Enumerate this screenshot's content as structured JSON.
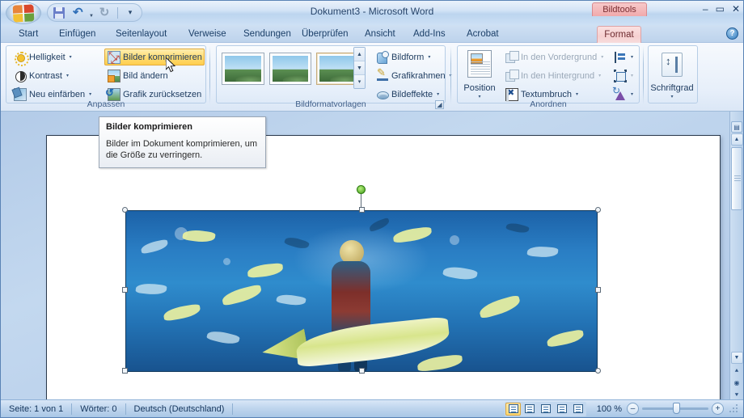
{
  "window": {
    "title": "Dokument3 - Microsoft Word",
    "contextual_tab_label": "Bildtools",
    "minimize": "–",
    "maximize": "▭",
    "close": "✕",
    "help_icon": "?"
  },
  "quick_access": {
    "office_button": "office-orb",
    "items": [
      {
        "name": "save",
        "icon": "save-icon"
      },
      {
        "name": "undo",
        "icon": "undo-icon",
        "caret": "▾"
      },
      {
        "name": "redo",
        "icon": "redo-icon"
      },
      {
        "name": "customize",
        "icon": "chevron-down-icon",
        "glyph": "▾"
      }
    ]
  },
  "tabs": [
    {
      "label": "Start",
      "active": false
    },
    {
      "label": "Einfügen",
      "active": false
    },
    {
      "label": "Seitenlayout",
      "active": false
    },
    {
      "label": "Verweise",
      "active": false
    },
    {
      "label": "Sendungen",
      "active": false
    },
    {
      "label": "Überprüfen",
      "active": false
    },
    {
      "label": "Ansicht",
      "active": false
    },
    {
      "label": "Add-Ins",
      "active": false
    },
    {
      "label": "Acrobat",
      "active": false
    },
    {
      "label": "Format",
      "active": true
    }
  ],
  "ribbon": {
    "groups": [
      {
        "title": "Anpassen",
        "items": [
          {
            "label": "Helligkeit",
            "icon": "brightness-icon",
            "caret": "▾",
            "disabled": false,
            "highlighted": false
          },
          {
            "label": "Kontrast",
            "icon": "contrast-icon",
            "caret": "▾",
            "disabled": false,
            "highlighted": false
          },
          {
            "label": "Neu einfärben",
            "icon": "recolor-icon",
            "caret": "▾",
            "disabled": false,
            "highlighted": false
          },
          {
            "label": "Bilder komprimieren",
            "icon": "compress-pictures-icon",
            "caret": "",
            "disabled": false,
            "highlighted": true
          },
          {
            "label": "Bild ändern",
            "icon": "change-picture-icon",
            "caret": "",
            "disabled": false,
            "highlighted": false
          },
          {
            "label": "Grafik zurücksetzen",
            "icon": "reset-picture-icon",
            "caret": "",
            "disabled": false,
            "highlighted": false
          }
        ]
      },
      {
        "title": "Bildformatvorlagen",
        "gallery_count": 3,
        "selected_index": 2,
        "items": [
          {
            "label": "Bildform",
            "icon": "picture-shape-icon",
            "caret": "▾",
            "disabled": false
          },
          {
            "label": "Grafikrahmen",
            "icon": "picture-border-icon",
            "caret": "▾",
            "disabled": false
          },
          {
            "label": "Bildeffekte",
            "icon": "picture-effects-icon",
            "caret": "▾",
            "disabled": false
          }
        ],
        "dialog_launcher": "◢"
      },
      {
        "title": "Anordnen",
        "big_button": {
          "label": "Position",
          "icon": "position-icon",
          "caret": "▾"
        },
        "items": [
          {
            "label": "In den Vordergrund",
            "icon": "bring-to-front-icon",
            "caret": "▾",
            "disabled": true
          },
          {
            "label": "In den Hintergrund",
            "icon": "send-to-back-icon",
            "caret": "▾",
            "disabled": true
          },
          {
            "label": "Textumbruch",
            "icon": "text-wrapping-icon",
            "caret": "▾",
            "disabled": false
          }
        ],
        "icon_only_items": [
          {
            "name": "align-icon",
            "caret": "▾",
            "disabled": false
          },
          {
            "name": "group-objects-icon",
            "caret": "▾",
            "disabled": true
          },
          {
            "name": "rotate-icon",
            "caret": "▾",
            "disabled": false
          }
        ]
      },
      {
        "title": "",
        "big_button": {
          "label": "Schriftgrad",
          "icon": "font-size-icon",
          "caret": "▾"
        }
      }
    ]
  },
  "tooltip": {
    "title": "Bilder komprimieren",
    "body": "Bilder im Dokument komprimieren, um die Größe zu verringern."
  },
  "document": {
    "page_background": "#ffffff",
    "selected_image": {
      "name": "aquarium-diver-photo",
      "alt": "Taucher zwischen Fischen in einem Aquarium",
      "selected": true,
      "rotation_handle": "green-rotation-handle",
      "handles": 8
    }
  },
  "scrollbars": {
    "vertical": {
      "up_arrow": "▲",
      "down_arrow": "▼",
      "prev_page": "⯅",
      "select_browse_object": "◉",
      "next_page": "⯆",
      "split_box": "split-box",
      "object_browse_icon": "browse-object-icon"
    }
  },
  "statusbar": {
    "page": "Seite: 1 von 1",
    "words": "Wörter: 0",
    "language": "Deutsch (Deutschland)",
    "zoom_level": "100 %",
    "zoom_out": "–",
    "zoom_in": "+",
    "views": [
      {
        "name": "print-layout-view",
        "glyph": "▤",
        "active": true
      },
      {
        "name": "full-screen-reading-view",
        "glyph": "▥",
        "active": false
      },
      {
        "name": "web-layout-view",
        "glyph": "▦",
        "active": false
      },
      {
        "name": "outline-view",
        "glyph": "▧",
        "active": false
      },
      {
        "name": "draft-view",
        "glyph": "▨",
        "active": false
      }
    ]
  },
  "colors": {
    "accent_orange": "#ffcf4e",
    "contextual_tab": "#f0a9ab",
    "chrome_blue": "#c5d9ef",
    "text_dark_blue": "#1e3a5f"
  }
}
